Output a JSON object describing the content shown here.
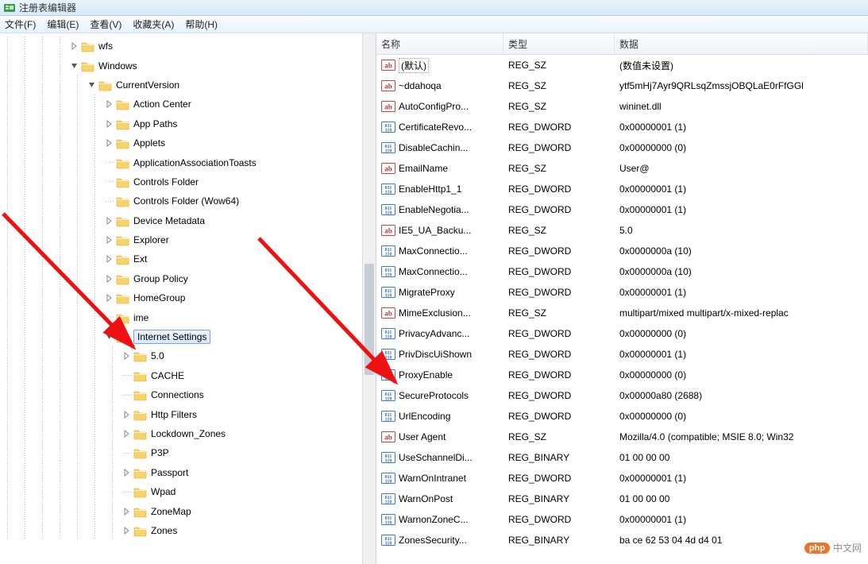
{
  "window": {
    "title": "注册表编辑器"
  },
  "menu": {
    "file": "文件(F)",
    "edit": "编辑(E)",
    "view": "查看(V)",
    "favorites": "收藏夹(A)",
    "help": "帮助(H)"
  },
  "columns": {
    "name": "名称",
    "type": "类型",
    "data": "数据",
    "name_w": 160,
    "type_w": 140
  },
  "tree": [
    {
      "indent": 4,
      "exp": "closed",
      "label": "wfs"
    },
    {
      "indent": 4,
      "exp": "open",
      "label": "Windows"
    },
    {
      "indent": 5,
      "exp": "open",
      "label": "CurrentVersion"
    },
    {
      "indent": 6,
      "exp": "closed",
      "label": "Action Center"
    },
    {
      "indent": 6,
      "exp": "closed",
      "label": "App Paths"
    },
    {
      "indent": 6,
      "exp": "closed",
      "label": "Applets"
    },
    {
      "indent": 6,
      "exp": "none",
      "label": "ApplicationAssociationToasts"
    },
    {
      "indent": 6,
      "exp": "none",
      "label": "Controls Folder"
    },
    {
      "indent": 6,
      "exp": "none",
      "label": "Controls Folder (Wow64)"
    },
    {
      "indent": 6,
      "exp": "closed",
      "label": "Device Metadata"
    },
    {
      "indent": 6,
      "exp": "closed",
      "label": "Explorer"
    },
    {
      "indent": 6,
      "exp": "closed",
      "label": "Ext"
    },
    {
      "indent": 6,
      "exp": "closed",
      "label": "Group Policy"
    },
    {
      "indent": 6,
      "exp": "closed",
      "label": "HomeGroup"
    },
    {
      "indent": 6,
      "exp": "none",
      "label": "ime"
    },
    {
      "indent": 6,
      "exp": "open",
      "label": "Internet Settings",
      "selected": true
    },
    {
      "indent": 7,
      "exp": "closed",
      "label": "5.0"
    },
    {
      "indent": 7,
      "exp": "none",
      "label": "CACHE"
    },
    {
      "indent": 7,
      "exp": "none",
      "label": "Connections"
    },
    {
      "indent": 7,
      "exp": "closed",
      "label": "Http Filters"
    },
    {
      "indent": 7,
      "exp": "closed",
      "label": "Lockdown_Zones"
    },
    {
      "indent": 7,
      "exp": "none",
      "label": "P3P"
    },
    {
      "indent": 7,
      "exp": "closed",
      "label": "Passport"
    },
    {
      "indent": 7,
      "exp": "none",
      "label": "Wpad"
    },
    {
      "indent": 7,
      "exp": "closed",
      "label": "ZoneMap"
    },
    {
      "indent": 7,
      "exp": "closed",
      "label": "Zones"
    }
  ],
  "values": [
    {
      "icon": "sz",
      "name": "(默认)",
      "type": "REG_SZ",
      "data": "(数值未设置)",
      "default": true
    },
    {
      "icon": "sz",
      "name": "~ddahoqa",
      "type": "REG_SZ",
      "data": "ytf5mHj7Ayr9QRLsqZmssjOBQLaE0rFfGGl"
    },
    {
      "icon": "sz",
      "name": "AutoConfigPro...",
      "type": "REG_SZ",
      "data": "wininet.dll"
    },
    {
      "icon": "bin",
      "name": "CertificateRevo...",
      "type": "REG_DWORD",
      "data": "0x00000001 (1)"
    },
    {
      "icon": "bin",
      "name": "DisableCachin...",
      "type": "REG_DWORD",
      "data": "0x00000000 (0)"
    },
    {
      "icon": "sz",
      "name": "EmailName",
      "type": "REG_SZ",
      "data": "User@"
    },
    {
      "icon": "bin",
      "name": "EnableHttp1_1",
      "type": "REG_DWORD",
      "data": "0x00000001 (1)"
    },
    {
      "icon": "bin",
      "name": "EnableNegotia...",
      "type": "REG_DWORD",
      "data": "0x00000001 (1)"
    },
    {
      "icon": "sz",
      "name": "IE5_UA_Backu...",
      "type": "REG_SZ",
      "data": "5.0"
    },
    {
      "icon": "bin",
      "name": "MaxConnectio...",
      "type": "REG_DWORD",
      "data": "0x0000000a (10)"
    },
    {
      "icon": "bin",
      "name": "MaxConnectio...",
      "type": "REG_DWORD",
      "data": "0x0000000a (10)"
    },
    {
      "icon": "bin",
      "name": "MigrateProxy",
      "type": "REG_DWORD",
      "data": "0x00000001 (1)"
    },
    {
      "icon": "sz",
      "name": "MimeExclusion...",
      "type": "REG_SZ",
      "data": "multipart/mixed multipart/x-mixed-replac"
    },
    {
      "icon": "bin",
      "name": "PrivacyAdvanc...",
      "type": "REG_DWORD",
      "data": "0x00000000 (0)"
    },
    {
      "icon": "bin",
      "name": "PrivDiscUiShown",
      "type": "REG_DWORD",
      "data": "0x00000001 (1)"
    },
    {
      "icon": "bin",
      "name": "ProxyEnable",
      "type": "REG_DWORD",
      "data": "0x00000000 (0)"
    },
    {
      "icon": "bin",
      "name": "SecureProtocols",
      "type": "REG_DWORD",
      "data": "0x00000a80 (2688)"
    },
    {
      "icon": "bin",
      "name": "UrlEncoding",
      "type": "REG_DWORD",
      "data": "0x00000000 (0)"
    },
    {
      "icon": "sz",
      "name": "User Agent",
      "type": "REG_SZ",
      "data": "Mozilla/4.0 (compatible; MSIE 8.0; Win32"
    },
    {
      "icon": "bin",
      "name": "UseSchannelDi...",
      "type": "REG_BINARY",
      "data": "01 00 00 00"
    },
    {
      "icon": "bin",
      "name": "WarnOnIntranet",
      "type": "REG_DWORD",
      "data": "0x00000001 (1)"
    },
    {
      "icon": "bin",
      "name": "WarnOnPost",
      "type": "REG_BINARY",
      "data": "01 00 00 00"
    },
    {
      "icon": "bin",
      "name": "WarnonZoneC...",
      "type": "REG_DWORD",
      "data": "0x00000001 (1)"
    },
    {
      "icon": "bin",
      "name": "ZonesSecurity...",
      "type": "REG_BINARY",
      "data": "ba ce 62 53 04 4d d4 01"
    }
  ],
  "watermark": {
    "badge": "php",
    "text": "中文网"
  }
}
